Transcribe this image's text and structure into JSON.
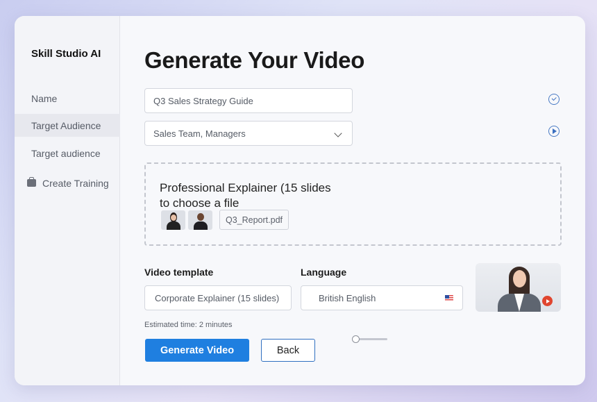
{
  "app": {
    "brand": "Skill Studio AI"
  },
  "sidebar": {
    "items": [
      {
        "label": "Name",
        "active": false
      },
      {
        "label": "Target Audience",
        "active": true
      },
      {
        "label": "Target audience",
        "active": false
      },
      {
        "label": "Create Training",
        "icon": "briefcase-icon",
        "active": false
      }
    ]
  },
  "main": {
    "title": "Generate Your Video",
    "name_field": {
      "value": "Q3 Sales Strategy Guide",
      "status_icon": "check-circle-icon"
    },
    "audience_select": {
      "value": "Sales Team, Managers",
      "status_icon": "play-circle-icon"
    },
    "dropzone": {
      "line1": "Professional Explainer (15 slides",
      "line2": "to choose a file",
      "avatars": [
        "avatar-woman-icon",
        "avatar-man-icon"
      ],
      "file_name": "Q3_Report.pdf"
    },
    "template": {
      "label": "Video template",
      "value": "Corporate Explainer (15 slides)"
    },
    "language": {
      "label": "Language",
      "value": "British English",
      "flag_icon": "uk-flag-icon"
    },
    "estimated_time": "Estimated time: 2 minutes",
    "generate_button": "Generate Video",
    "back_button": "Back"
  },
  "colors": {
    "primary": "#1f7fe0",
    "accent_outline": "#2f6fc0",
    "preview_play": "#e0452f"
  }
}
